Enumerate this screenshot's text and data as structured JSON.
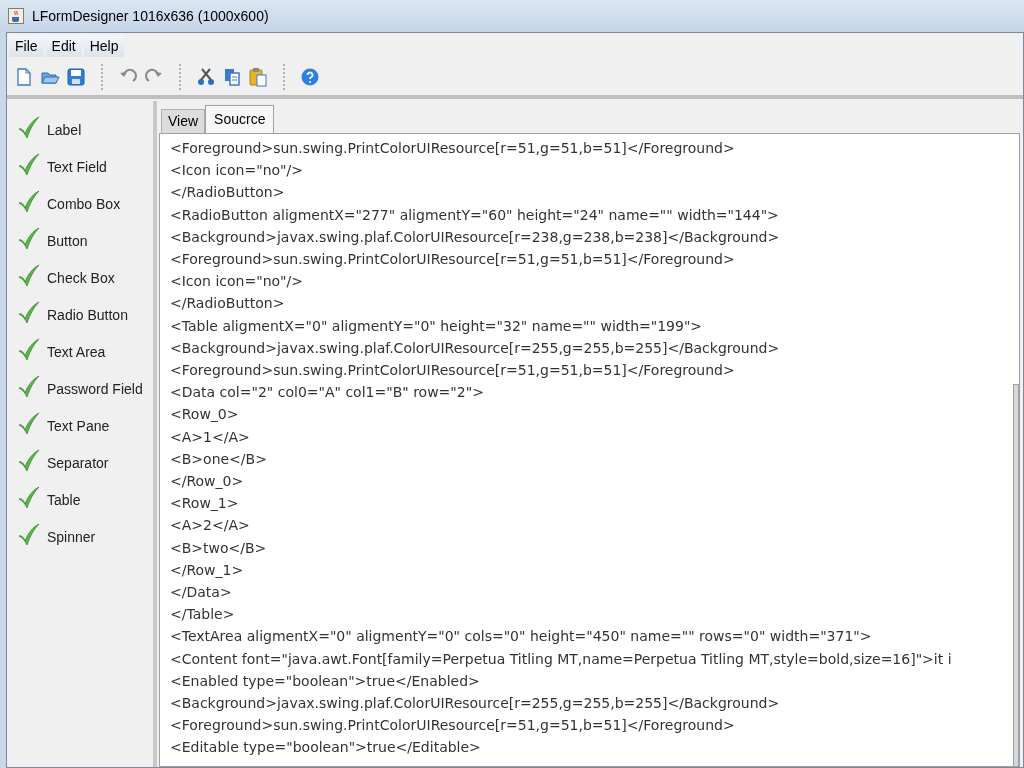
{
  "window": {
    "title": "LFormDesigner 1016x636 (1000x600)"
  },
  "menu": [
    "File",
    "Edit",
    "Help"
  ],
  "toolbar": [
    {
      "kind": "new"
    },
    {
      "kind": "open"
    },
    {
      "kind": "save"
    },
    {
      "kind": "sep"
    },
    {
      "kind": "undo"
    },
    {
      "kind": "redo"
    },
    {
      "kind": "sep"
    },
    {
      "kind": "cut"
    },
    {
      "kind": "copy"
    },
    {
      "kind": "paste"
    },
    {
      "kind": "sep"
    },
    {
      "kind": "help"
    }
  ],
  "palette": [
    "Label",
    "Text Field",
    "Combo Box",
    "Button",
    "Check Box",
    "Radio Button",
    "Text Area",
    "Password Field",
    "Text Pane",
    "Separator",
    "Table",
    "Spinner"
  ],
  "tabs": [
    {
      "label": "View",
      "selected": false
    },
    {
      "label": "Soucrce",
      "selected": true
    }
  ],
  "source_lines": [
    "<Foreground>sun.swing.PrintColorUIResource[r=51,g=51,b=51]</Foreground>",
    "<Icon icon=\"no\"/>",
    "</RadioButton>",
    "<RadioButton aligmentX=\"277\" aligmentY=\"60\" height=\"24\" name=\"\" width=\"144\">",
    "<Background>javax.swing.plaf.ColorUIResource[r=238,g=238,b=238]</Background>",
    "<Foreground>sun.swing.PrintColorUIResource[r=51,g=51,b=51]</Foreground>",
    "<Icon icon=\"no\"/>",
    "</RadioButton>",
    "<Table aligmentX=\"0\" aligmentY=\"0\" height=\"32\" name=\"\" width=\"199\">",
    "<Background>javax.swing.plaf.ColorUIResource[r=255,g=255,b=255]</Background>",
    "<Foreground>sun.swing.PrintColorUIResource[r=51,g=51,b=51]</Foreground>",
    "<Data col=\"2\" col0=\"A\" col1=\"B\" row=\"2\">",
    "<Row_0>",
    "<A>1</A>",
    "<B>one</B>",
    "</Row_0>",
    "<Row_1>",
    "<A>2</A>",
    "<B>two</B>",
    "</Row_1>",
    "</Data>",
    "</Table>",
    "<TextArea aligmentX=\"0\" aligmentY=\"0\" cols=\"0\" height=\"450\" name=\"\" rows=\"0\" width=\"371\">",
    "<Content font=\"java.awt.Font[family=Perpetua Titling MT,name=Perpetua Titling MT,style=bold,size=16]\">it i",
    "<Enabled type=\"boolean\">true</Enabled>",
    "<Background>javax.swing.plaf.ColorUIResource[r=255,g=255,b=255]</Background>",
    "<Foreground>sun.swing.PrintColorUIResource[r=51,g=51,b=51]</Foreground>",
    "<Editable type=\"boolean\">true</Editable>"
  ]
}
